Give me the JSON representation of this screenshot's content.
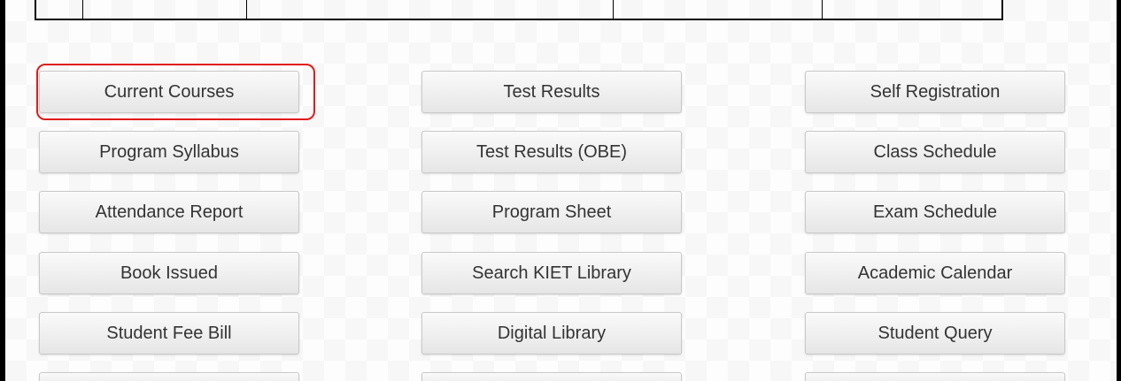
{
  "columns": [
    {
      "buttons": [
        "Current Courses",
        "Program Syllabus",
        "Attendance Report",
        "Book Issued",
        "Student Fee Bill"
      ]
    },
    {
      "buttons": [
        "Test Results",
        "Test Results (OBE)",
        "Program Sheet",
        "Search KIET Library",
        "Digital Library"
      ]
    },
    {
      "buttons": [
        "Self Registration",
        "Class Schedule",
        "Exam Schedule",
        "Academic Calendar",
        "Student Query"
      ]
    }
  ],
  "highlighted_button": "Current Courses",
  "colors": {
    "highlight_border": "#e11b1b",
    "button_text": "#333333"
  }
}
